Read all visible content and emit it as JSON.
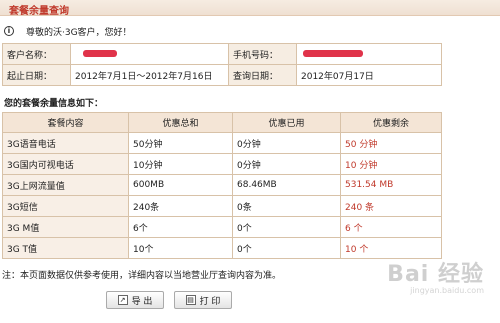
{
  "header": {
    "title": "套餐余量查询"
  },
  "notice": {
    "icon": "info-icon",
    "text": "尊敬的沃·3G客户，您好！"
  },
  "info": {
    "customer_label": "客户名称：",
    "phone_label": "手机号码：",
    "start_label": "起止日期：",
    "start_value": "2012年7月1日～2012年7月16日",
    "query_label": "查询日期：",
    "query_value": "2012年07月17日"
  },
  "subtitle": "您的套餐余量信息如下：",
  "table": {
    "headers": [
      "套餐内容",
      "优惠总和",
      "优惠已用",
      "优惠剩余"
    ],
    "rows": [
      [
        "3G语音电话",
        "50分钟",
        "0分钟",
        "50 分钟"
      ],
      [
        "3G国内可视电话",
        "10分钟",
        "0分钟",
        "10 分钟"
      ],
      [
        "3G上网流量值",
        "600MB",
        "68.46MB",
        "531.54 MB"
      ],
      [
        "3G短信",
        "240条",
        "0条",
        "240 条"
      ],
      [
        "3G M值",
        "6个",
        "0个",
        "6 个"
      ],
      [
        "3G T值",
        "10个",
        "0个",
        "10 个"
      ]
    ]
  },
  "footnote": "注：本页面数据仅供参考使用，详细内容以当地营业厅查询内容为准。",
  "buttons": {
    "export": "导 出",
    "print": "打 印"
  },
  "watermark": {
    "text": "Bai 经验",
    "url": "jingyan.baidu.com"
  },
  "colors": {
    "accent": "#c0392b",
    "header_bg": "#efe0d2",
    "redaction": "#e0334a"
  }
}
